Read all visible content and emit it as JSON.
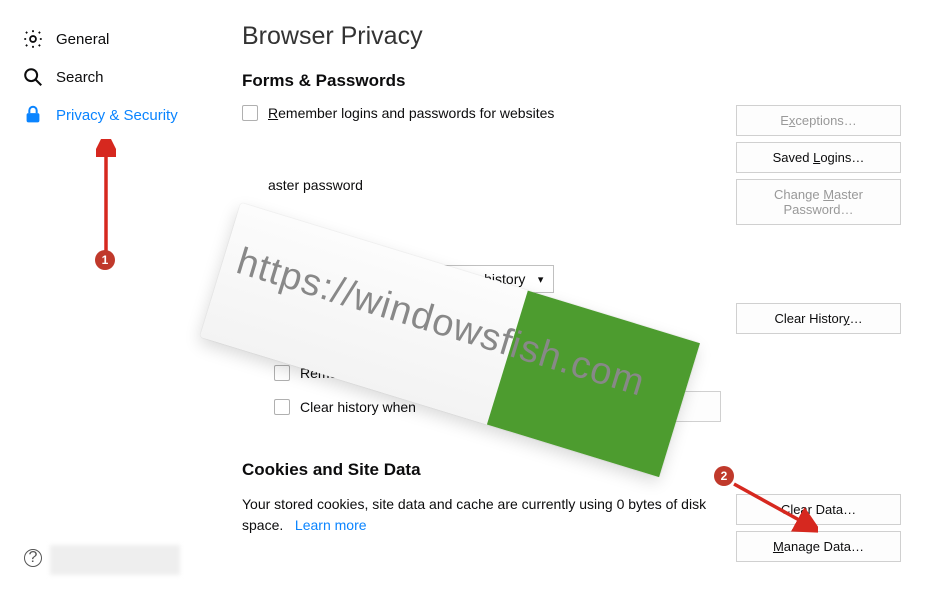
{
  "sidebar": {
    "items": [
      {
        "label": "General"
      },
      {
        "label": "Search"
      },
      {
        "label": "Privacy & Security"
      }
    ]
  },
  "page": {
    "title": "Browser Privacy"
  },
  "forms": {
    "heading": "Forms & Passwords",
    "remember": "Remember logins and passwords for websites",
    "master": "aster password",
    "exceptions": "Exceptions…",
    "saved_logins": "Saved Logins…",
    "change_master": "Change Master Password…",
    "accel_r": "R",
    "accel_l": "L",
    "accel_m": "M"
  },
  "history": {
    "dropdown_suffix": "s for history",
    "clear_history": "Clear History…",
    "opt_re_prefix": "Re",
    "opt_remember_partial": "Remember",
    "opt_clear_partial": "Clear history when",
    "settings": "Settings…"
  },
  "cookies": {
    "heading": "Cookies and Site Data",
    "desc_part1": "Your stored cookies, site data and cache are currently using 0 bytes of disk space.",
    "learn_more": "Learn more",
    "clear_data": "Clear Data…",
    "manage_data": "Manage Data…",
    "accel_l": "l",
    "accel_m": "M"
  },
  "annotations": {
    "badge1": "1",
    "badge2": "2"
  },
  "watermark": {
    "text": "https://windowsfish.com"
  }
}
